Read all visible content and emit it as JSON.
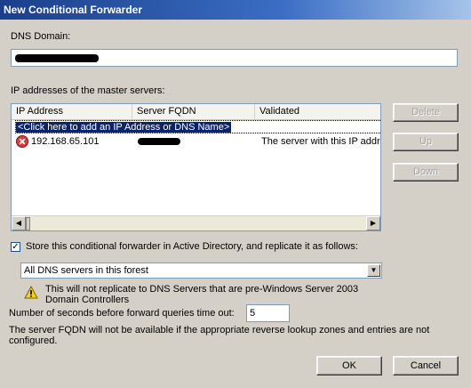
{
  "window": {
    "title": "New Conditional Forwarder"
  },
  "dns_domain": {
    "label": "DNS Domain:",
    "value": ""
  },
  "master_servers": {
    "label": "IP addresses of the master servers:",
    "columns": [
      "IP Address",
      "Server FQDN",
      "Validated"
    ],
    "add_placeholder": "<Click here to add an IP Address or DNS Name>",
    "rows": [
      {
        "ip": "192.168.65.101",
        "fqdn": "",
        "validated": "The server with this IP addre",
        "status_icon": "error-x-icon"
      }
    ]
  },
  "buttons": {
    "delete": "Delete",
    "up": "Up",
    "down": "Down",
    "ok": "OK",
    "cancel": "Cancel"
  },
  "store_ad": {
    "label": "Store this conditional forwarder in Active Directory, and replicate it as follows:",
    "checked": true,
    "check_glyph": "✓"
  },
  "replication_scope": {
    "selected": "All DNS servers in this forest"
  },
  "warning": {
    "line1": "This will not replicate to DNS Servers that are pre-Windows Server 2003",
    "line2": "Domain Controllers",
    "icon": "warning-triangle-icon"
  },
  "timeout": {
    "label": "Number of seconds before forward queries time out:",
    "value": "5"
  },
  "footer_note": {
    "line1": "The server FQDN will not be available if the appropriate reverse lookup zones and entries are not",
    "line2": "configured."
  },
  "colors": {
    "titlebar": "#1b3f8a",
    "dialog_bg": "#d4d0c8",
    "selection": "#0a246a",
    "error_red": "#d93c3c",
    "warning_yellow": "#f5d20f"
  }
}
